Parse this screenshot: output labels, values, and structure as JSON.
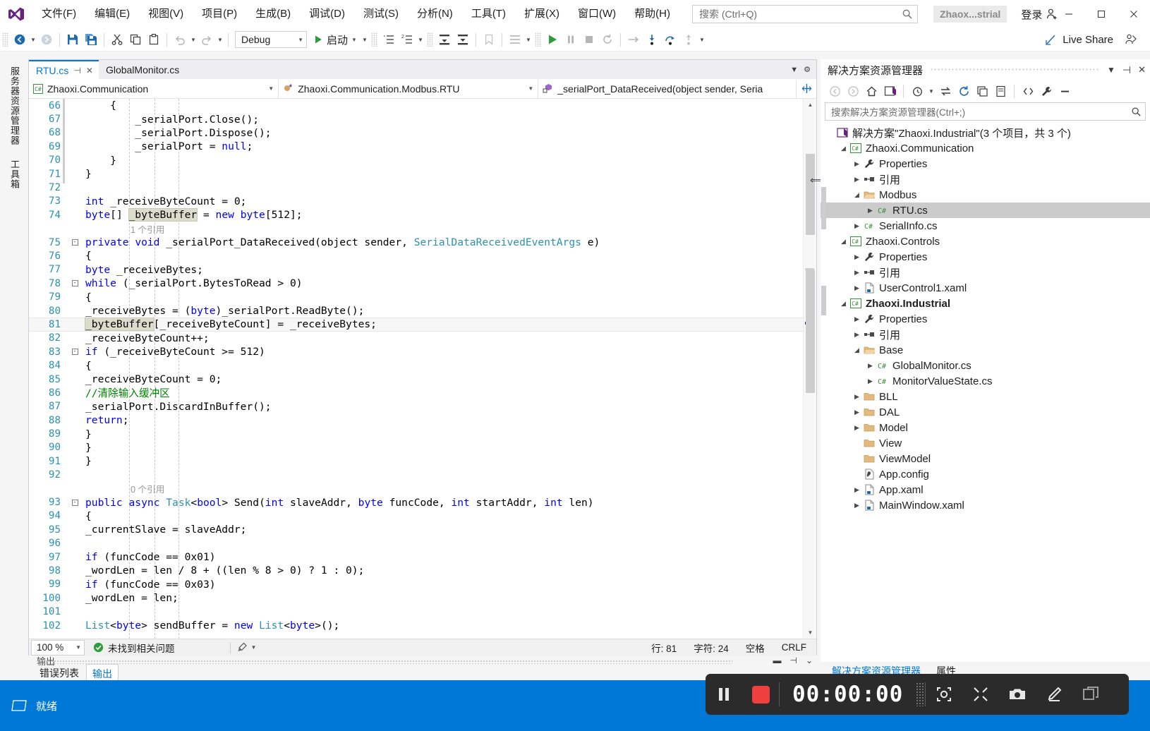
{
  "titlebar": {
    "logo_icon": "visual-studio-logo",
    "menus": [
      {
        "label": "文件(F)"
      },
      {
        "label": "编辑(E)"
      },
      {
        "label": "视图(V)"
      },
      {
        "label": "项目(P)"
      },
      {
        "label": "生成(B)"
      },
      {
        "label": "调试(D)"
      },
      {
        "label": "测试(S)"
      },
      {
        "label": "分析(N)"
      },
      {
        "label": "工具(T)"
      },
      {
        "label": "扩展(X)"
      },
      {
        "label": "窗口(W)"
      },
      {
        "label": "帮助(H)"
      }
    ],
    "search_placeholder": "搜索 (Ctrl+Q)",
    "search_icon": "search-icon",
    "project_chip": "Zhaox...strial",
    "signin_label": "登录",
    "signin_icon": "person-add-icon",
    "minimize_icon": "minimize-icon",
    "maximize_icon": "maximize-icon",
    "close_icon": "close-icon"
  },
  "toolbar": {
    "back_icon": "navigate-back-icon",
    "forward_icon": "navigate-forward-icon",
    "save_icon": "save-icon",
    "save_all_icon": "save-all-icon",
    "cut_icon": "cut-icon",
    "copy_icon": "copy-icon",
    "paste_icon": "paste-icon",
    "undo_icon": "undo-icon",
    "redo_icon": "redo-icon",
    "config_value": "Debug",
    "start_label": "启动",
    "start_icon": "play-icon",
    "live_share_label": "Live Share",
    "live_share_icon": "live-share-icon",
    "feedback_icon": "feedback-icon"
  },
  "vertical_tabs": [
    {
      "label": "服务器资源管理器"
    },
    {
      "label": "工具箱"
    }
  ],
  "editor": {
    "tabs": [
      {
        "label": "RTU.cs",
        "active": true,
        "pin_icon": "pin-icon",
        "close_icon": "close-icon"
      },
      {
        "label": "GlobalMonitor.cs",
        "active": false
      }
    ],
    "tab_menu_icon": "chevron-down-icon",
    "tab_settings_icon": "gear-icon",
    "nav_namespace": "Zhaoxi.Communication",
    "nav_namespace_icon": "csharp-icon",
    "nav_class": "Zhaoxi.Communication.Modbus.RTU",
    "nav_class_icon": "class-icon",
    "nav_member": "_serialPort_DataReceived(object sender, Seria",
    "nav_member_icon": "method-private-icon",
    "split_icon": "split-view-icon",
    "first_visible_line": 65,
    "lines": [
      {
        "num": "66",
        "fold": "",
        "indent": 3,
        "text": "    {"
      },
      {
        "num": "67",
        "fold": "",
        "indent": 3,
        "text": "        _serialPort.Close();"
      },
      {
        "num": "68",
        "fold": "",
        "indent": 3,
        "text": "        _serialPort.Dispose();"
      },
      {
        "num": "69",
        "fold": "",
        "indent": 3,
        "text": "        _serialPort = null;"
      },
      {
        "num": "70",
        "fold": "",
        "indent": 3,
        "text": "    }"
      },
      {
        "num": "71",
        "fold": "",
        "indent": 2,
        "text": "}"
      },
      {
        "num": "72",
        "fold": "",
        "indent": 0,
        "text": ""
      },
      {
        "num": "73",
        "fold": "",
        "indent": 2,
        "text": "int _receiveByteCount = 0;"
      },
      {
        "num": "74",
        "fold": "",
        "indent": 2,
        "text": "byte[] _byteBuffer = new byte[512];"
      },
      {
        "num": "",
        "fold": "",
        "ref": "1 个引用"
      },
      {
        "num": "75",
        "fold": "-",
        "indent": 2,
        "text": "private void _serialPort_DataReceived(object sender, SerialDataReceivedEventArgs e)"
      },
      {
        "num": "76",
        "fold": "",
        "indent": 2,
        "text": "{"
      },
      {
        "num": "77",
        "fold": "",
        "indent": 3,
        "text": "byte _receiveBytes;"
      },
      {
        "num": "78",
        "fold": "-",
        "indent": 3,
        "text": "while (_serialPort.BytesToRead > 0)"
      },
      {
        "num": "79",
        "fold": "",
        "indent": 3,
        "text": "{"
      },
      {
        "num": "80",
        "fold": "",
        "indent": 4,
        "text": "_receiveBytes = (byte)_serialPort.ReadByte();"
      },
      {
        "num": "81",
        "fold": "",
        "indent": 4,
        "text": "_byteBuffer[_receiveByteCount] = _receiveBytes;",
        "current": true
      },
      {
        "num": "82",
        "fold": "",
        "indent": 4,
        "text": "_receiveByteCount++;"
      },
      {
        "num": "83",
        "fold": "-",
        "indent": 4,
        "text": "if (_receiveByteCount >= 512)"
      },
      {
        "num": "84",
        "fold": "",
        "indent": 4,
        "text": "{"
      },
      {
        "num": "85",
        "fold": "",
        "indent": 5,
        "text": "_receiveByteCount = 0;"
      },
      {
        "num": "86",
        "fold": "",
        "indent": 5,
        "text": "//清除输入缓冲区"
      },
      {
        "num": "87",
        "fold": "",
        "indent": 5,
        "text": "_serialPort.DiscardInBuffer();"
      },
      {
        "num": "88",
        "fold": "",
        "indent": 5,
        "text": "return;"
      },
      {
        "num": "89",
        "fold": "",
        "indent": 4,
        "text": "}"
      },
      {
        "num": "90",
        "fold": "",
        "indent": 3,
        "text": "}"
      },
      {
        "num": "91",
        "fold": "",
        "indent": 2,
        "text": "}"
      },
      {
        "num": "92",
        "fold": "",
        "indent": 0,
        "text": ""
      },
      {
        "num": "",
        "fold": "",
        "ref": "0 个引用"
      },
      {
        "num": "93",
        "fold": "-",
        "indent": 2,
        "text": "public async Task<bool> Send(int slaveAddr, byte funcCode, int startAddr, int len)"
      },
      {
        "num": "94",
        "fold": "",
        "indent": 2,
        "text": "{"
      },
      {
        "num": "95",
        "fold": "",
        "indent": 3,
        "text": "_currentSlave = slaveAddr;"
      },
      {
        "num": "96",
        "fold": "",
        "indent": 0,
        "text": ""
      },
      {
        "num": "97",
        "fold": "",
        "indent": 3,
        "text": "if (funcCode == 0x01)"
      },
      {
        "num": "98",
        "fold": "",
        "indent": 4,
        "text": "_wordLen = len / 8 + ((len % 8 > 0) ? 1 : 0);"
      },
      {
        "num": "99",
        "fold": "",
        "indent": 3,
        "text": "if (funcCode == 0x03)"
      },
      {
        "num": "100",
        "fold": "",
        "indent": 4,
        "text": "_wordLen = len;"
      },
      {
        "num": "101",
        "fold": "",
        "indent": 0,
        "text": ""
      },
      {
        "num": "102",
        "fold": "",
        "indent": 3,
        "text": "List<byte> sendBuffer = new List<byte>();"
      }
    ],
    "status": {
      "zoom": "100 %",
      "problems_icon": "check-circle-icon",
      "problems_label": "未找到相关问题",
      "brush_icon": "brush-icon",
      "line_label": "行: 81",
      "col_label": "字符: 24",
      "space_label": "空格",
      "eol_label": "CRLF"
    }
  },
  "bottom_dock": {
    "title": "输出",
    "tabs": [
      {
        "label": "错误列表",
        "selected": false
      },
      {
        "label": "输出",
        "selected": true
      }
    ],
    "minimize_icon": "minimize-icon",
    "pin_icon": "pin-icon",
    "close_icon": "chevron-down-icon"
  },
  "solution_explorer": {
    "title": "解决方案资源管理器",
    "dropdown_icon": "chevron-down-icon",
    "pin_icon": "pin-icon",
    "close_icon": "close-icon",
    "toolbar_icons": [
      "back-icon",
      "forward-icon",
      "home-icon",
      "switch-views-icon",
      "pending-changes-icon",
      "sync-icon",
      "refresh-icon",
      "collapse-all-icon",
      "properties-window-icon",
      "show-all-files-icon",
      "wrench-icon",
      "minus-icon"
    ],
    "search_placeholder": "搜索解决方案资源管理器(Ctrl+;)",
    "search_icon": "search-icon",
    "tree": [
      {
        "depth": 0,
        "twisty": "",
        "icon": "solution-icon",
        "label": "解决方案\"Zhaoxi.Industrial\"(3 个项目，共 3 个)",
        "bold": false
      },
      {
        "depth": 1,
        "twisty": "▲",
        "icon": "csharp-project-icon",
        "label": "Zhaoxi.Communication",
        "bold": false
      },
      {
        "depth": 2,
        "twisty": "▶",
        "icon": "wrench-icon",
        "label": "Properties",
        "bold": false
      },
      {
        "depth": 2,
        "twisty": "▶",
        "icon": "references-icon",
        "label": "引用",
        "bold": false
      },
      {
        "depth": 2,
        "twisty": "▲",
        "icon": "folder-open-icon",
        "label": "Modbus",
        "bold": false
      },
      {
        "depth": 3,
        "twisty": "▶",
        "icon": "csharp-file-icon",
        "label": "RTU.cs",
        "bold": false,
        "selected": true
      },
      {
        "depth": 2,
        "twisty": "▶",
        "icon": "csharp-file-icon",
        "label": "SerialInfo.cs",
        "bold": false
      },
      {
        "depth": 1,
        "twisty": "▲",
        "icon": "csharp-project-icon",
        "label": "Zhaoxi.Controls",
        "bold": false
      },
      {
        "depth": 2,
        "twisty": "▶",
        "icon": "wrench-icon",
        "label": "Properties",
        "bold": false
      },
      {
        "depth": 2,
        "twisty": "▶",
        "icon": "references-icon",
        "label": "引用",
        "bold": false
      },
      {
        "depth": 2,
        "twisty": "▶",
        "icon": "xaml-file-icon",
        "label": "UserControl1.xaml",
        "bold": false
      },
      {
        "depth": 1,
        "twisty": "▲",
        "icon": "csharp-project-icon",
        "label": "Zhaoxi.Industrial",
        "bold": true
      },
      {
        "depth": 2,
        "twisty": "▶",
        "icon": "wrench-icon",
        "label": "Properties",
        "bold": false
      },
      {
        "depth": 2,
        "twisty": "▶",
        "icon": "references-icon",
        "label": "引用",
        "bold": false
      },
      {
        "depth": 2,
        "twisty": "▲",
        "icon": "folder-open-icon",
        "label": "Base",
        "bold": false
      },
      {
        "depth": 3,
        "twisty": "▶",
        "icon": "csharp-file-icon",
        "label": "GlobalMonitor.cs",
        "bold": false
      },
      {
        "depth": 3,
        "twisty": "▶",
        "icon": "csharp-file-icon",
        "label": "MonitorValueState.cs",
        "bold": false
      },
      {
        "depth": 2,
        "twisty": "▶",
        "icon": "folder-icon",
        "label": "BLL",
        "bold": false
      },
      {
        "depth": 2,
        "twisty": "▶",
        "icon": "folder-icon",
        "label": "DAL",
        "bold": false
      },
      {
        "depth": 2,
        "twisty": "▶",
        "icon": "folder-icon",
        "label": "Model",
        "bold": false
      },
      {
        "depth": 2,
        "twisty": "",
        "icon": "folder-icon",
        "label": "View",
        "bold": false
      },
      {
        "depth": 2,
        "twisty": "",
        "icon": "folder-icon",
        "label": "ViewModel",
        "bold": false
      },
      {
        "depth": 2,
        "twisty": "",
        "icon": "config-file-icon",
        "label": "App.config",
        "bold": false
      },
      {
        "depth": 2,
        "twisty": "▶",
        "icon": "xaml-file-icon",
        "label": "App.xaml",
        "bold": false
      },
      {
        "depth": 2,
        "twisty": "▶",
        "icon": "xaml-file-icon",
        "label": "MainWindow.xaml",
        "bold": false
      }
    ],
    "bottom_tabs": [
      {
        "label": "解决方案资源管理器",
        "selected": true
      },
      {
        "label": "属性",
        "selected": false
      }
    ]
  },
  "taskbar": {
    "start_icon": "window-icon",
    "status_label": "就绪"
  },
  "recorder": {
    "pause_icon": "pause-icon",
    "stop_icon": "stop-icon",
    "time": "00:00:00",
    "tools": [
      {
        "icon": "region-capture-icon"
      },
      {
        "icon": "fullscreen-icon"
      },
      {
        "icon": "camera-icon"
      },
      {
        "icon": "pen-icon"
      },
      {
        "icon": "window-capture-icon"
      }
    ]
  },
  "colors": {
    "accent": "#0078d4",
    "taskbar": "#0078d7",
    "keyword": "#0000ff",
    "type": "#2b91af",
    "comment": "#008000",
    "record_red": "#f03f3f"
  }
}
